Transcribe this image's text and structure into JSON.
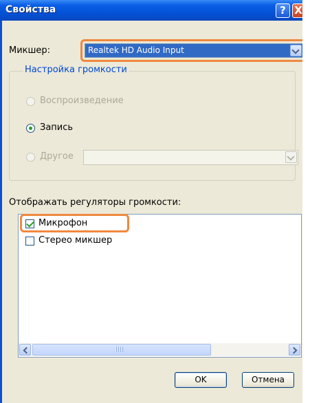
{
  "window": {
    "title": "Свойства",
    "help_glyph": "?",
    "close_glyph": "X"
  },
  "mixer": {
    "label": "Микшер:",
    "selected": "Realtek HD Audio Input"
  },
  "volume_group": {
    "title": "Настройка громкости",
    "options": [
      {
        "label": "Воспроизведение",
        "checked": false,
        "enabled": false
      },
      {
        "label": "Запись",
        "checked": true,
        "enabled": true
      },
      {
        "label": "Другое",
        "checked": false,
        "enabled": false
      }
    ],
    "other_select_value": ""
  },
  "controls": {
    "label": "Отображать регуляторы громкости:",
    "items": [
      {
        "label": "Микрофон",
        "checked": true
      },
      {
        "label": "Стерео микшер",
        "checked": false
      }
    ]
  },
  "buttons": {
    "ok": "OK",
    "cancel": "Отмена"
  },
  "colors": {
    "highlight": "#f0883e",
    "title_bar": "#0453d8",
    "selection": "#316ac5"
  },
  "icons": [
    "help-icon",
    "close-icon",
    "chevron-down-icon",
    "checkmark-icon",
    "scroll-left-icon",
    "scroll-right-icon"
  ]
}
